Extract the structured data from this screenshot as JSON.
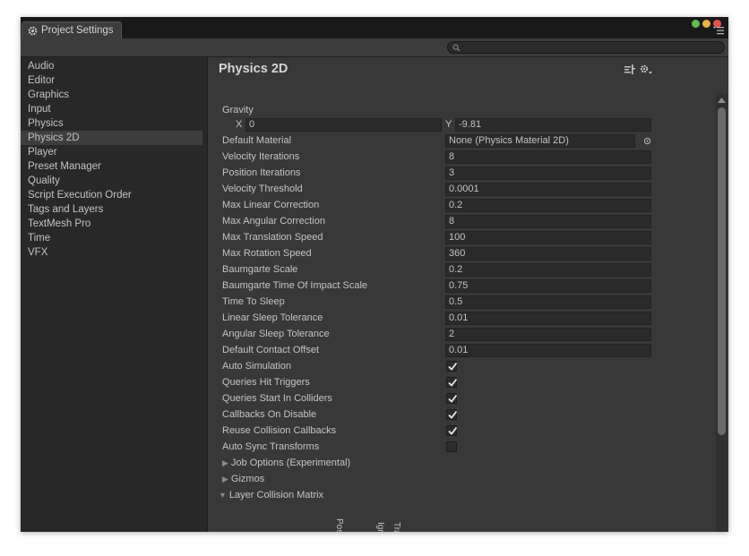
{
  "window": {
    "tab_title": "Project Settings",
    "search": {
      "placeholder": ""
    }
  },
  "sidebar": {
    "items": [
      {
        "label": "Audio",
        "selected": false
      },
      {
        "label": "Editor",
        "selected": false
      },
      {
        "label": "Graphics",
        "selected": false
      },
      {
        "label": "Input",
        "selected": false
      },
      {
        "label": "Physics",
        "selected": false
      },
      {
        "label": "Physics 2D",
        "selected": true
      },
      {
        "label": "Player",
        "selected": false
      },
      {
        "label": "Preset Manager",
        "selected": false
      },
      {
        "label": "Quality",
        "selected": false
      },
      {
        "label": "Script Execution Order",
        "selected": false
      },
      {
        "label": "Tags and Layers",
        "selected": false
      },
      {
        "label": "TextMesh Pro",
        "selected": false
      },
      {
        "label": "Time",
        "selected": false
      },
      {
        "label": "VFX",
        "selected": false
      }
    ]
  },
  "panel": {
    "title": "Physics 2D",
    "gravity": {
      "label": "Gravity",
      "x_label": "X",
      "x_value": "0",
      "y_label": "Y",
      "y_value": "-9.81"
    },
    "default_material": {
      "label": "Default Material",
      "value": "None (Physics Material 2D)"
    },
    "fields": [
      {
        "label": "Velocity Iterations",
        "value": "8"
      },
      {
        "label": "Position Iterations",
        "value": "3"
      },
      {
        "label": "Velocity Threshold",
        "value": "0.0001"
      },
      {
        "label": "Max Linear Correction",
        "value": "0.2"
      },
      {
        "label": "Max Angular Correction",
        "value": "8"
      },
      {
        "label": "Max Translation Speed",
        "value": "100"
      },
      {
        "label": "Max Rotation Speed",
        "value": "360"
      },
      {
        "label": "Baumgarte Scale",
        "value": "0.2"
      },
      {
        "label": "Baumgarte Time Of Impact Scale",
        "value": "0.75"
      },
      {
        "label": "Time To Sleep",
        "value": "0.5"
      },
      {
        "label": "Linear Sleep Tolerance",
        "value": "0.01"
      },
      {
        "label": "Angular Sleep Tolerance",
        "value": "2"
      },
      {
        "label": "Default Contact Offset",
        "value": "0.01"
      }
    ],
    "toggles": [
      {
        "label": "Auto Simulation",
        "checked": true
      },
      {
        "label": "Queries Hit Triggers",
        "checked": true
      },
      {
        "label": "Queries Start In Colliders",
        "checked": true
      },
      {
        "label": "Callbacks On Disable",
        "checked": true
      },
      {
        "label": "Reuse Collision Callbacks",
        "checked": true
      },
      {
        "label": "Auto Sync Transforms",
        "checked": false
      }
    ],
    "foldouts": [
      {
        "label": "Job Options (Experimental)",
        "expanded": false
      },
      {
        "label": "Gizmos",
        "expanded": false
      },
      {
        "label": "Layer Collision Matrix",
        "expanded": true
      }
    ],
    "matrix_headers": [
      "PostPr",
      "Ignor",
      "Trans"
    ]
  },
  "colors": {
    "window_bg": "#282828",
    "panel_bg": "#383838",
    "selected_bg": "#3e3e3e",
    "text": "#c4c4c4",
    "field_bg": "#2a2a2a"
  },
  "icons": [
    "settings-gear-icon",
    "search-icon",
    "close-dot-icon",
    "minimize-dot-icon",
    "maximize-dot-icon",
    "menu-icon",
    "preset-icon",
    "settings-dropdown-icon",
    "object-picker-icon",
    "checkmark-icon",
    "foldout-triangle-icon"
  ]
}
